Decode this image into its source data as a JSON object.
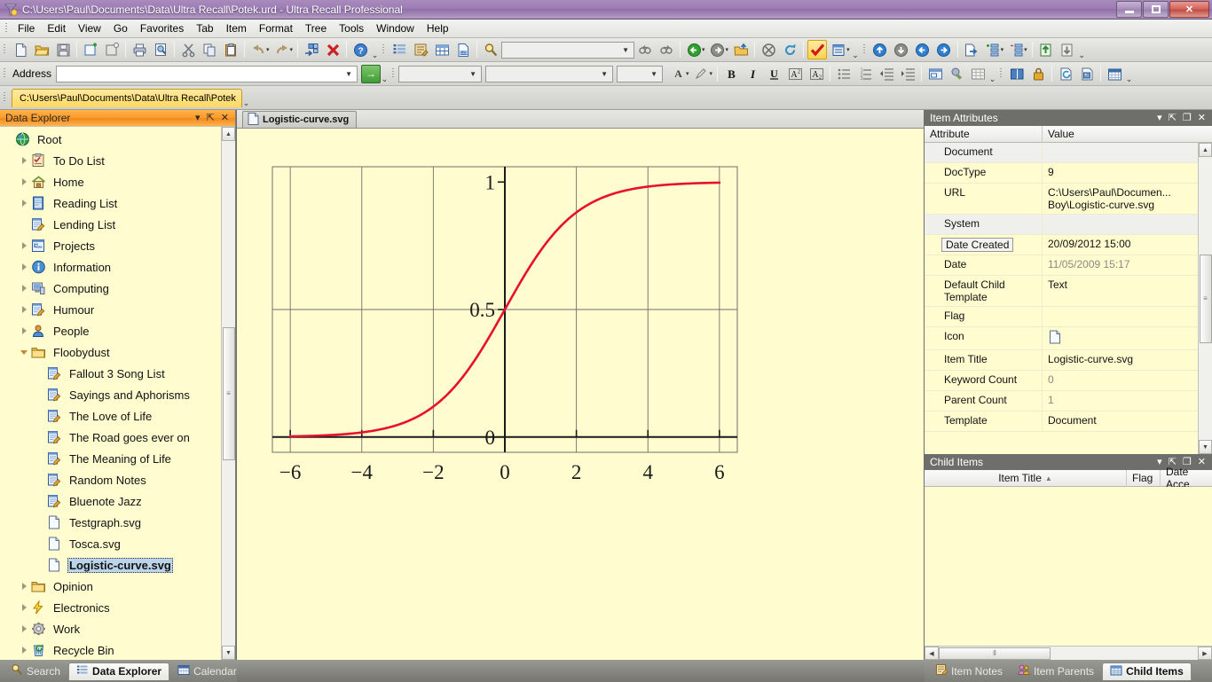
{
  "window": {
    "title": "C:\\Users\\Paul\\Documents\\Data\\Ultra Recall\\Potek.urd - Ultra Recall Professional",
    "app_icon": "ultra-recall-icon",
    "minimize": "–",
    "restore": "❐",
    "close": "✕"
  },
  "menu": {
    "items": [
      {
        "label": "File"
      },
      {
        "label": "Edit"
      },
      {
        "label": "View"
      },
      {
        "label": "Go"
      },
      {
        "label": "Favorites"
      },
      {
        "label": "Tab"
      },
      {
        "label": "Item"
      },
      {
        "label": "Format"
      },
      {
        "label": "Tree"
      },
      {
        "label": "Tools"
      },
      {
        "label": "Window"
      },
      {
        "label": "Help"
      }
    ]
  },
  "toolbar": {
    "address_label": "Address",
    "address_value": "",
    "address_placeholder": "",
    "go_button": "→",
    "search_value": "",
    "font_name": "",
    "font_size": "",
    "style_value": "",
    "bold": "B",
    "italic": "I",
    "underline": "U",
    "superscript": "A²",
    "subscript": "A₂",
    "overflow": "⌄"
  },
  "db_tabs": [
    {
      "label": "C:\\Users\\Paul\\Documents\\Data\\Ultra Recall\\Potek",
      "active": true
    }
  ],
  "data_explorer": {
    "title": "Data Explorer",
    "buttons": {
      "menu": "▾",
      "pin": "⇱",
      "close": "✕"
    },
    "tree": [
      {
        "label": "Root",
        "icon": "globe-icon",
        "depth": 0,
        "expander": "none",
        "selected": false
      },
      {
        "label": "To Do List",
        "icon": "checklist-icon",
        "depth": 1,
        "expander": "closed",
        "selected": false
      },
      {
        "label": "Home",
        "icon": "home-icon",
        "depth": 1,
        "expander": "closed",
        "selected": false
      },
      {
        "label": "Reading List",
        "icon": "book-icon",
        "depth": 1,
        "expander": "closed",
        "selected": false
      },
      {
        "label": "Lending List",
        "icon": "notepad-icon",
        "depth": 1,
        "expander": "none",
        "selected": false
      },
      {
        "label": "Projects",
        "icon": "project-icon",
        "depth": 1,
        "expander": "closed",
        "selected": false
      },
      {
        "label": "Information",
        "icon": "info-icon",
        "depth": 1,
        "expander": "closed",
        "selected": false
      },
      {
        "label": "Computing",
        "icon": "computer-icon",
        "depth": 1,
        "expander": "closed",
        "selected": false
      },
      {
        "label": "Humour",
        "icon": "notepad-icon",
        "depth": 1,
        "expander": "closed",
        "selected": false
      },
      {
        "label": "People",
        "icon": "person-icon",
        "depth": 1,
        "expander": "closed",
        "selected": false
      },
      {
        "label": "Floobydust",
        "icon": "folder-icon",
        "depth": 1,
        "expander": "open",
        "selected": false
      },
      {
        "label": "Fallout 3 Song List",
        "icon": "notepad-icon",
        "depth": 2,
        "expander": "none",
        "selected": false
      },
      {
        "label": "Sayings and Aphorisms",
        "icon": "notepad-icon",
        "depth": 2,
        "expander": "none",
        "selected": false
      },
      {
        "label": "The Love of Life",
        "icon": "notepad-icon",
        "depth": 2,
        "expander": "none",
        "selected": false
      },
      {
        "label": "The Road goes ever on",
        "icon": "notepad-icon",
        "depth": 2,
        "expander": "none",
        "selected": false
      },
      {
        "label": "The Meaning of Life",
        "icon": "notepad-icon",
        "depth": 2,
        "expander": "none",
        "selected": false
      },
      {
        "label": "Random Notes",
        "icon": "notepad-icon",
        "depth": 2,
        "expander": "none",
        "selected": false
      },
      {
        "label": "Bluenote Jazz",
        "icon": "notepad-icon",
        "depth": 2,
        "expander": "none",
        "selected": false
      },
      {
        "label": "Testgraph.svg",
        "icon": "document-icon",
        "depth": 2,
        "expander": "none",
        "selected": false
      },
      {
        "label": "Tosca.svg",
        "icon": "document-icon",
        "depth": 2,
        "expander": "none",
        "selected": false
      },
      {
        "label": "Logistic-curve.svg",
        "icon": "document-icon",
        "depth": 2,
        "expander": "none",
        "selected": true
      },
      {
        "label": "Opinion",
        "icon": "folder-icon",
        "depth": 1,
        "expander": "closed",
        "selected": false
      },
      {
        "label": "Electronics",
        "icon": "lightning-icon",
        "depth": 1,
        "expander": "closed",
        "selected": false
      },
      {
        "label": "Work",
        "icon": "gear-icon",
        "depth": 1,
        "expander": "closed",
        "selected": false
      },
      {
        "label": "Recycle Bin",
        "icon": "recycle-bin-icon",
        "depth": 1,
        "expander": "closed",
        "selected": false
      }
    ]
  },
  "document": {
    "tab_label": "Logistic-curve.svg",
    "tab_icon": "document-icon"
  },
  "chart_data": {
    "type": "line",
    "title": "",
    "xlabel": "",
    "ylabel": "",
    "xlim": [
      -6.5,
      6.5
    ],
    "ylim": [
      -0.06,
      1.06
    ],
    "xticks": [
      -6,
      -4,
      -2,
      0,
      2,
      4,
      6
    ],
    "xticklabels": [
      "−6",
      "−4",
      "−2",
      "0",
      "2",
      "4",
      "6"
    ],
    "yticks": [
      0,
      0.5,
      1
    ],
    "yticklabels": [
      "0",
      "0.5",
      "1"
    ],
    "grid": true,
    "grid_x": [
      -6,
      -4,
      -2,
      2,
      4,
      6
    ],
    "grid_y": [
      0.5
    ],
    "line_color": "#e8112d",
    "background": "#fffccf",
    "series": [
      {
        "name": "logistic",
        "formula": "1 / (1 + exp(-x))",
        "x": [
          -6,
          -5.5,
          -5,
          -4.5,
          -4,
          -3.5,
          -3,
          -2.5,
          -2,
          -1.5,
          -1,
          -0.5,
          0,
          0.5,
          1,
          1.5,
          2,
          2.5,
          3,
          3.5,
          4,
          4.5,
          5,
          5.5,
          6
        ],
        "y": [
          0.0025,
          0.0041,
          0.0067,
          0.011,
          0.018,
          0.0293,
          0.0474,
          0.0759,
          0.1192,
          0.1824,
          0.2689,
          0.3775,
          0.5,
          0.6225,
          0.7311,
          0.8176,
          0.8808,
          0.9241,
          0.9526,
          0.9707,
          0.982,
          0.989,
          0.9933,
          0.9959,
          0.9975
        ]
      }
    ]
  },
  "item_attributes": {
    "title": "Item Attributes",
    "buttons": {
      "menu": "▾",
      "pin": "⇱",
      "maximize": "❐",
      "close": "✕"
    },
    "columns": [
      "Attribute",
      "Value"
    ],
    "rows": [
      {
        "name": "Document",
        "value": "",
        "group": true
      },
      {
        "name": "DocType",
        "value": "9"
      },
      {
        "name": "URL",
        "value": "C:\\Users\\Paul\\Documen...\nBoy\\Logistic-curve.svg"
      },
      {
        "name": "System",
        "value": "",
        "group": true
      },
      {
        "name": "Date Created",
        "value": "20/09/2012 15:00",
        "selected": true
      },
      {
        "name": "Date",
        "value": "11/05/2009 15:17",
        "dim": true
      },
      {
        "name": "Default Child Template",
        "value": "Text"
      },
      {
        "name": "Flag",
        "value": ""
      },
      {
        "name": "Icon",
        "value": "",
        "icon": "document-icon"
      },
      {
        "name": "Item Title",
        "value": "Logistic-curve.svg"
      },
      {
        "name": "Keyword Count",
        "value": "0",
        "dim": true
      },
      {
        "name": "Parent Count",
        "value": "1",
        "dim": true
      },
      {
        "name": "Template",
        "value": "Document"
      }
    ]
  },
  "child_items": {
    "title": "Child Items",
    "buttons": {
      "menu": "▾",
      "pin": "⇱",
      "maximize": "❐",
      "close": "✕"
    },
    "columns": [
      {
        "label": "Item Title",
        "sort": "▲"
      },
      {
        "label": "Flag",
        "sort": ""
      },
      {
        "label": "Date Acce",
        "sort": ""
      }
    ],
    "rows": []
  },
  "bottom_tabs_left": [
    {
      "label": "Search",
      "icon": "magnifier-icon",
      "active": false
    },
    {
      "label": "Data Explorer",
      "icon": "explorer-icon",
      "active": true
    },
    {
      "label": "Calendar",
      "icon": "calendar-icon",
      "active": false
    }
  ],
  "bottom_tabs_right": [
    {
      "label": "Item Notes",
      "icon": "notepad-icon",
      "active": false
    },
    {
      "label": "Item Parents",
      "icon": "people-icon",
      "active": false
    },
    {
      "label": "Child Items",
      "icon": "grid-icon",
      "active": true
    }
  ],
  "colors": {
    "titlebar": "#9d7db4",
    "panel_bg": "#fffccf",
    "explorer_header": "#fb9a2d",
    "panel_header": "#6e6e6a",
    "curve": "#e8112d",
    "selection": "#bcd4ea"
  }
}
